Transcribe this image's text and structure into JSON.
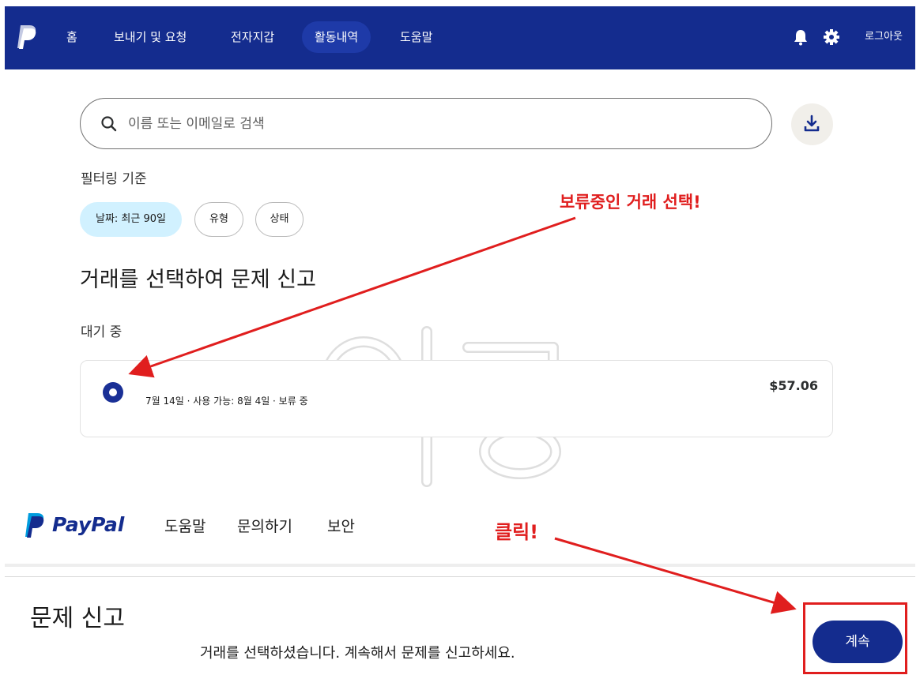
{
  "nav": {
    "items": [
      {
        "label": "홈"
      },
      {
        "label": "보내기 및 요청"
      },
      {
        "label": "전자지갑"
      },
      {
        "label": "활동내역"
      },
      {
        "label": "도움말"
      }
    ],
    "active_index": 3,
    "logout": "로그아웃",
    "icons": [
      "bell-icon",
      "gear-icon"
    ]
  },
  "search": {
    "placeholder": "이름 또는 이메일로 검색"
  },
  "filters": {
    "label": "필터링 기준",
    "chips": [
      {
        "label": "날짜: 최근 90일",
        "selected": true
      },
      {
        "label": "유형",
        "selected": false
      },
      {
        "label": "상태",
        "selected": false
      }
    ]
  },
  "main": {
    "title": "거래를 선택하여 문제 신고",
    "pending_label": "대기 중",
    "transaction": {
      "description": "7월 14일 · 사용 가능: 8월 4일 · 보류 중",
      "amount": "$57.06",
      "selected": true
    }
  },
  "footer": {
    "brand": "PayPal",
    "links": [
      "도움말",
      "문의하기",
      "보안"
    ]
  },
  "report_bar": {
    "title": "문제 신고",
    "message": "거래를 선택하셨습니다. 계속해서 문제를 신고하세요.",
    "continue_label": "계속"
  },
  "annotations": {
    "select_note": "보류중인 거래 선택!",
    "click_note": "클릭!"
  },
  "colors": {
    "brand_navy": "#142c8e",
    "chip_selected": "#d1f1ff",
    "annotation_red": "#e01e1e"
  }
}
